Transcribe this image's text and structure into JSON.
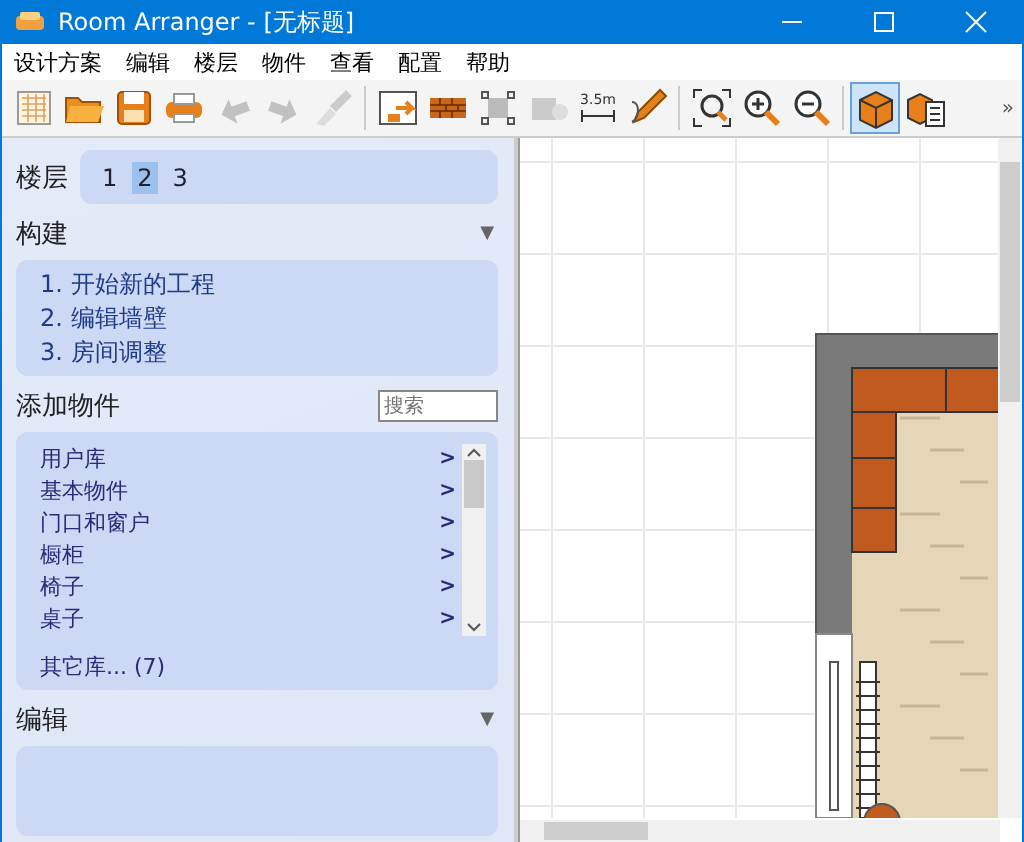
{
  "window": {
    "title": "Room Arranger - [无标题]"
  },
  "menu": [
    "设计方案",
    "编辑",
    "楼层",
    "物件",
    "查看",
    "配置",
    "帮助"
  ],
  "toolbar": [
    {
      "kind": "new",
      "disabled": false,
      "selected": false
    },
    {
      "kind": "open",
      "disabled": false,
      "selected": false
    },
    {
      "kind": "save",
      "disabled": false,
      "selected": false
    },
    {
      "kind": "print",
      "disabled": false,
      "selected": false
    },
    {
      "kind": "undo",
      "disabled": true,
      "selected": false
    },
    {
      "kind": "redo",
      "disabled": true,
      "selected": false
    },
    {
      "kind": "brush",
      "disabled": true,
      "selected": false
    },
    {
      "kind": "sep"
    },
    {
      "kind": "import",
      "disabled": false,
      "selected": false
    },
    {
      "kind": "wall",
      "disabled": false,
      "selected": false
    },
    {
      "kind": "select",
      "disabled": false,
      "selected": false
    },
    {
      "kind": "object",
      "disabled": true,
      "selected": false
    },
    {
      "kind": "dimension",
      "disabled": false,
      "selected": false,
      "label": "3.5m"
    },
    {
      "kind": "pencil",
      "disabled": false,
      "selected": false
    },
    {
      "kind": "sep"
    },
    {
      "kind": "zoomfit",
      "disabled": false,
      "selected": false
    },
    {
      "kind": "zoomin",
      "disabled": false,
      "selected": false
    },
    {
      "kind": "zoomout",
      "disabled": false,
      "selected": false
    },
    {
      "kind": "sep"
    },
    {
      "kind": "view3d",
      "disabled": false,
      "selected": true
    },
    {
      "kind": "list",
      "disabled": false,
      "selected": false
    }
  ],
  "toolbar_more": "»",
  "floors": {
    "label": "楼层",
    "items": [
      {
        "label": "1",
        "selected": false
      },
      {
        "label": "2",
        "selected": true
      },
      {
        "label": "3",
        "selected": false
      }
    ]
  },
  "build": {
    "title": "构建",
    "toggle": "▼",
    "steps": [
      "1. 开始新的工程",
      "2. 编辑墙壁",
      "3. 房间调整"
    ]
  },
  "add": {
    "title": "添加物件",
    "search": {
      "placeholder": "搜索"
    },
    "items": [
      {
        "label": "用户库",
        "arrow": ">"
      },
      {
        "label": "基本物件",
        "arrow": ">"
      },
      {
        "label": "门口和窗户",
        "arrow": ">"
      },
      {
        "label": "橱柜",
        "arrow": ">"
      },
      {
        "label": "椅子",
        "arrow": ">"
      },
      {
        "label": "桌子",
        "arrow": ">"
      }
    ],
    "more": "其它库... (7)"
  },
  "edit": {
    "title": "编辑",
    "toggle": "▼"
  }
}
